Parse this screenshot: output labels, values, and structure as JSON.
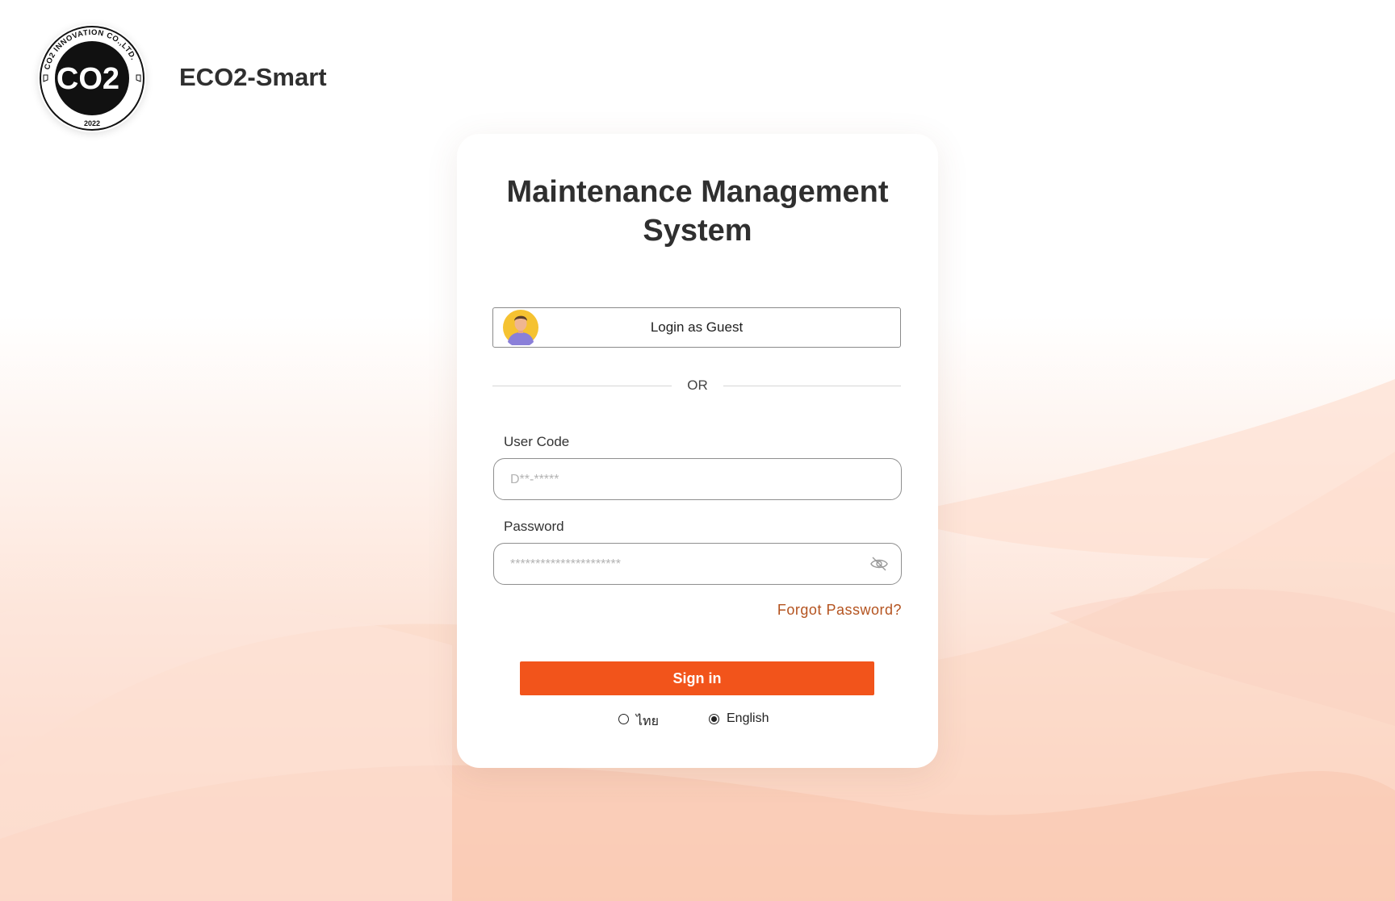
{
  "brand": {
    "name": "ECO2-Smart",
    "logo_ring_text": "CO2 INNOVATION CO.,LTD.",
    "logo_center_text": "CO2",
    "logo_year": "2022"
  },
  "login_card": {
    "title": "Maintenance Management\nSystem",
    "guest_button_label": "Login as Guest",
    "divider_text": "OR",
    "user_code": {
      "label": "User Code",
      "placeholder": "D**-*****",
      "value": ""
    },
    "password": {
      "label": "Password",
      "placeholder": "**********************",
      "value": ""
    },
    "forgot_password_label": "Forgot Password?",
    "signin_label": "Sign in",
    "languages": [
      {
        "label": "ไทย",
        "selected": false
      },
      {
        "label": "English",
        "selected": true
      }
    ]
  },
  "colors": {
    "accent": "#f2541b",
    "link": "#b4531f",
    "text": "#2f2f2f",
    "background_tint": "#fbd3c3"
  },
  "icons": {
    "guest_avatar": "user-avatar-icon",
    "password_toggle": "eye-slash-icon"
  }
}
